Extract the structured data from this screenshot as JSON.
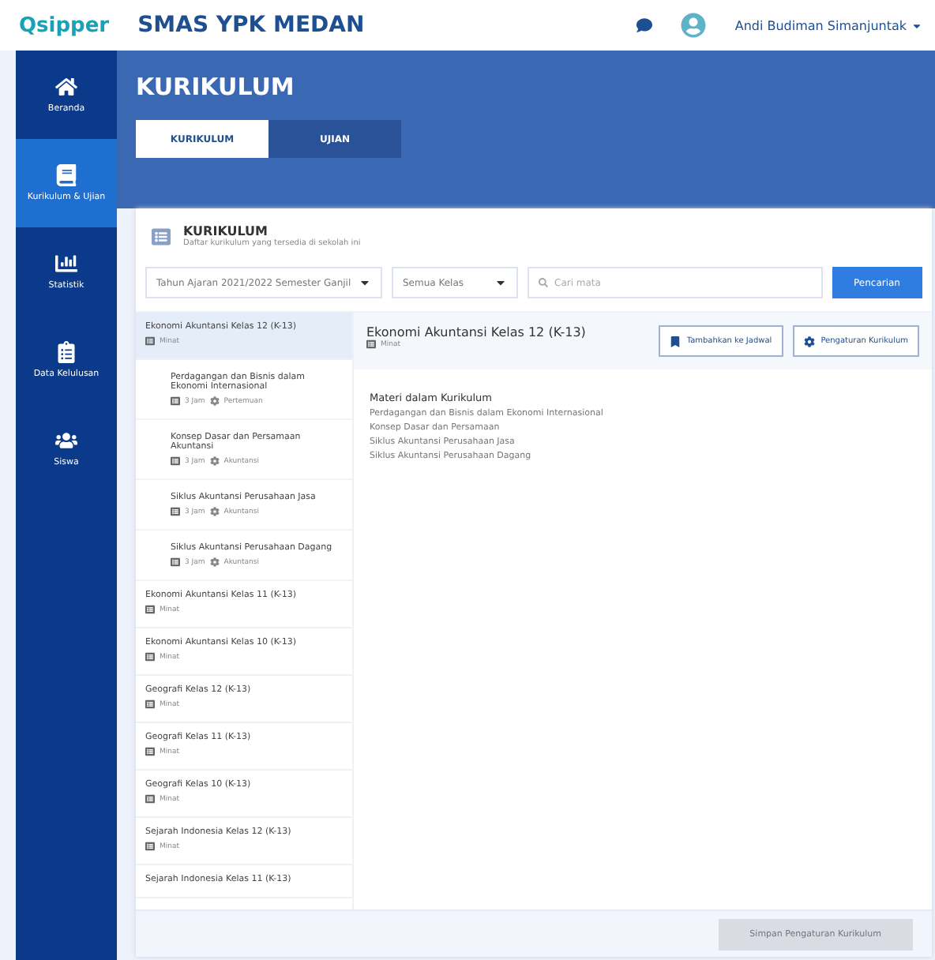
{
  "topbar": {
    "logo": "Qsipper",
    "school": "SMAS YPK MEDAN",
    "user": "Andi Budiman Simanjuntak"
  },
  "sidebar": {
    "items": [
      {
        "label": "Beranda",
        "selected": false
      },
      {
        "label": "Kurikulum & Ujian",
        "selected": true
      },
      {
        "label": "Statistik",
        "selected": false
      },
      {
        "label": "Data Kelulusan",
        "selected": false
      },
      {
        "label": "Siswa",
        "selected": false
      }
    ]
  },
  "header": {
    "title": "KURIKULUM"
  },
  "tabs": [
    {
      "label": "KURIKULUM",
      "selected": true
    },
    {
      "label": "UJIAN",
      "selected": false
    }
  ],
  "card": {
    "title": "KURIKULUM",
    "subtitle": "Daftar kurikulum yang tersedia di sekolah ini"
  },
  "filters": {
    "period": "Tahun Ajaran 2021/2022 Semester Ganjil",
    "class": "Semua Kelas",
    "search_placeholder": "Cari mata",
    "search_button": "Pencarian"
  },
  "curricula": [
    {
      "title": "Ekonomi Akuntansi Kelas 12 (K-13)",
      "tag": "Minat",
      "selected": true,
      "children": [
        {
          "title": "Perdagangan dan Bisnis dalam Ekonomi Internasional",
          "hours": "3 Jam",
          "sessions": "Pertemuan"
        },
        {
          "title": "Konsep Dasar dan Persamaan Akuntansi",
          "hours": "3 Jam",
          "sessions": "Akuntansi"
        },
        {
          "title": "Siklus Akuntansi Perusahaan Jasa",
          "hours": "3 Jam",
          "sessions": "Akuntansi"
        },
        {
          "title": "Siklus Akuntansi Perusahaan Dagang",
          "hours": "3 Jam",
          "sessions": "Akuntansi"
        }
      ]
    },
    {
      "title": "Ekonomi Akuntansi Kelas 11 (K-13)",
      "tag": "Minat",
      "selected": false
    },
    {
      "title": "Ekonomi Akuntansi Kelas 10 (K-13)",
      "tag": "Minat",
      "selected": false
    },
    {
      "title": "Geografi Kelas 12 (K-13)",
      "tag": "Minat",
      "selected": false
    },
    {
      "title": "Geografi Kelas 11 (K-13)",
      "tag": "Minat",
      "selected": false
    },
    {
      "title": "Geografi Kelas 10 (K-13)",
      "tag": "Minat",
      "selected": false
    },
    {
      "title": "Sejarah Indonesia Kelas 12 (K-13)",
      "tag": "Minat",
      "selected": false
    },
    {
      "title": "Sejarah Indonesia Kelas 11 (K-13)",
      "selected": false
    }
  ],
  "detail": {
    "title": "Ekonomi Akuntansi Kelas 12 (K-13)",
    "tag": "Minat",
    "buttons": [
      {
        "label": "Tambahkan ke Jadwal"
      },
      {
        "label": "Pengaturan Kurikulum"
      }
    ],
    "materials_heading": "Materi dalam Kurikulum",
    "materials": [
      "Perdagangan dan Bisnis dalam Ekonomi Internasional",
      "Konsep Dasar dan Persamaan",
      "Siklus Akuntansi Perusahaan Jasa",
      "Siklus Akuntansi Perusahaan Dagang"
    ]
  },
  "footer": {
    "button": "Simpan Pengaturan Kurikulum",
    "disabled": true
  }
}
